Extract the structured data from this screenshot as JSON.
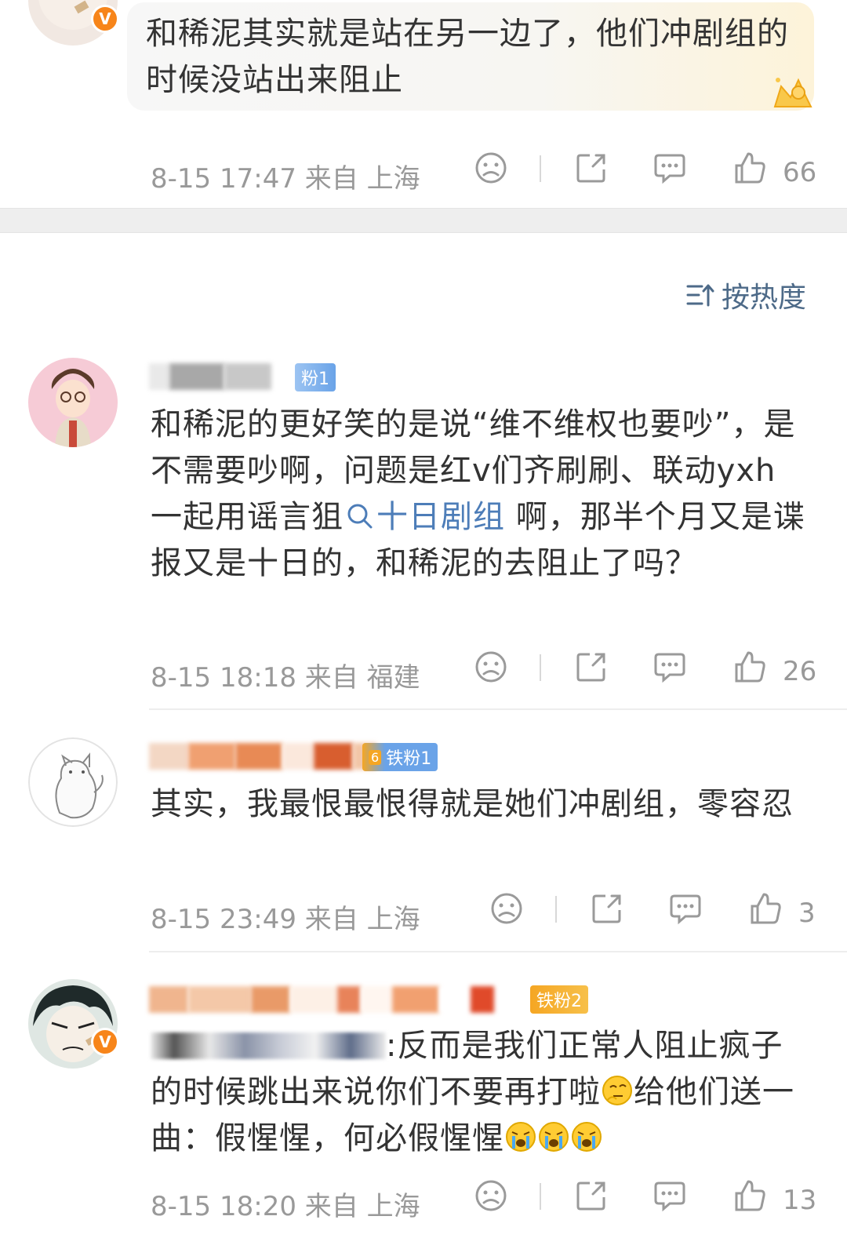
{
  "top_comment": {
    "text": "和稀泥其实就是站在另一边了，他们冲剧组的时候没站出来阻止",
    "time": "8-15 17:47",
    "location": "来自 上海",
    "likes": "66"
  },
  "sort": {
    "label": "按热度"
  },
  "comments": [
    {
      "fan_badge": "粉1",
      "text_before": "和稀泥的更好笑的是说“维不维权也要吵”，是不需要吵啊，问题是红v们齐刷刷、联动yxh 一起用谣言狙",
      "topic_link": "十日剧组",
      "text_after": " 啊，那半个月又是谍报又是十日的，和稀泥的去阻止了吗？",
      "time": "8-15 18:18",
      "location": "来自 福建",
      "likes": "26"
    },
    {
      "fan_badge": "铁粉1",
      "fan_level": "6",
      "text": "其实，我最恨最恨得就是她们冲剧组，零容忍",
      "time": "8-15 23:49",
      "location": "来自 上海",
      "likes": "3"
    },
    {
      "fan_badge": "铁粉2",
      "text_before": ":反而是我们正常人阻止疯子的时候跳出来说你们不要再打啦",
      "text_middle": "给他们送一曲：假惺惺，何必假惺惺",
      "time": "8-15 18:20",
      "location": "来自 上海",
      "likes": "13"
    }
  ],
  "icons": {
    "dislike": "sad-face-icon",
    "share": "share-icon",
    "comment": "comment-bubble-icon",
    "like": "thumbs-up-icon",
    "sort": "sort-icon",
    "verified": "verified-v-icon"
  },
  "colors": {
    "meta_gray": "#999999",
    "text": "#333333",
    "link_blue": "#4d7db8",
    "verified_orange": "#f7851a",
    "fan_blue": "#6aa3e8",
    "fan_orange": "#f5a623"
  }
}
